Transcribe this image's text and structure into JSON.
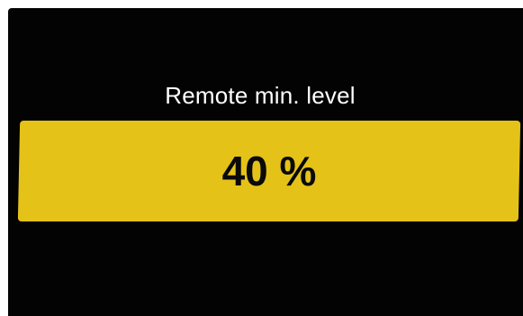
{
  "setting": {
    "title": "Remote min. level",
    "value_text": "40 %",
    "value_percent": 40
  },
  "colors": {
    "background": "#030303",
    "accent": "#e5c218",
    "title_text": "#ffffff",
    "value_text": "#0a0a0a"
  }
}
